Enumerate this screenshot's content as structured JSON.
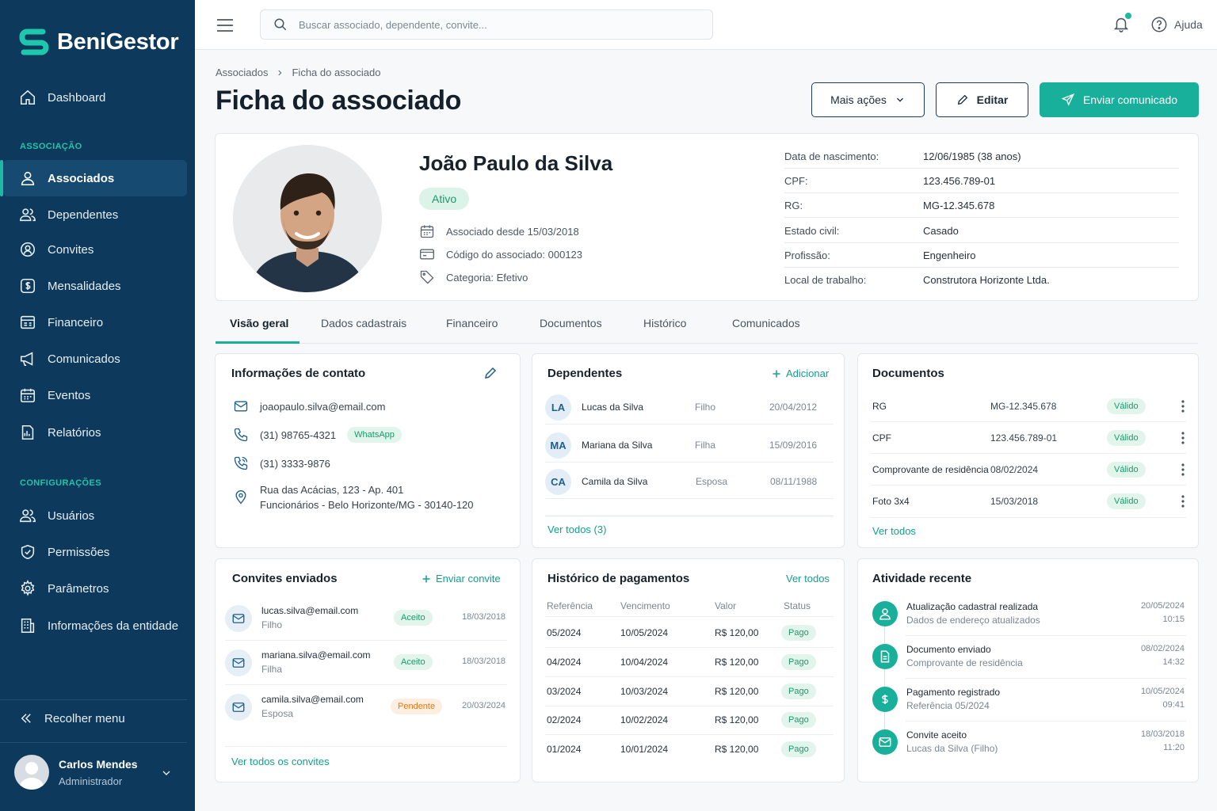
{
  "brand": {
    "name": "BeniGestor",
    "accent": "#18b09a",
    "sidebar_bg": "#0d3a5c"
  },
  "sidebar": {
    "items_top": [
      {
        "label": "Dashboard",
        "icon": "home-icon"
      }
    ],
    "section_assoc": "ASSOCIAÇÃO",
    "items_assoc": [
      {
        "label": "Associados",
        "icon": "user-icon",
        "active": true
      },
      {
        "label": "Dependentes",
        "icon": "users-icon"
      },
      {
        "label": "Convites",
        "icon": "invite-icon"
      },
      {
        "label": "Mensalidades",
        "icon": "dollar-icon"
      },
      {
        "label": "Financeiro",
        "icon": "finance-icon"
      },
      {
        "label": "Comunicados",
        "icon": "megaphone-icon"
      },
      {
        "label": "Eventos",
        "icon": "calendar-icon"
      },
      {
        "label": "Relatórios",
        "icon": "report-icon"
      }
    ],
    "section_config": "CONFIGURAÇÕES",
    "items_config": [
      {
        "label": "Usuários",
        "icon": "users-icon"
      },
      {
        "label": "Permissões",
        "icon": "shield-icon"
      },
      {
        "label": "Parâmetros",
        "icon": "gear-icon"
      },
      {
        "label": "Informações da entidade",
        "icon": "building-icon"
      }
    ],
    "collapse_label": "Recolher menu",
    "user": {
      "name": "Carlos Mendes",
      "role": "Administrador"
    }
  },
  "topbar": {
    "search_placeholder": "Buscar associado, dependente, convite...",
    "help_label": "Ajuda"
  },
  "header": {
    "breadcrumb": [
      "Associados",
      "Ficha do associado"
    ],
    "title": "Ficha do associado",
    "btn_more": "Mais ações",
    "btn_edit": "Editar",
    "btn_send": "Enviar comunicado"
  },
  "profile": {
    "name": "João Paulo da Silva",
    "status": "Ativo",
    "since": "Associado desde 15/03/2018",
    "code": "Código do associado: 000123",
    "category": "Categoria: Efetivo",
    "details": [
      {
        "k": "Data de nascimento:",
        "v": "12/06/1985 (38 anos)"
      },
      {
        "k": "CPF:",
        "v": "123.456.789-01"
      },
      {
        "k": "RG:",
        "v": "MG-12.345.678"
      },
      {
        "k": "Estado civil:",
        "v": "Casado"
      },
      {
        "k": "Profissão:",
        "v": "Engenheiro"
      },
      {
        "k": "Local de trabalho:",
        "v": "Construtora Horizonte Ltda."
      }
    ]
  },
  "tabs": [
    "Visão geral",
    "Dados cadastrais",
    "Financeiro",
    "Documentos",
    "Histórico",
    "Comunicados"
  ],
  "contact": {
    "title": "Informações de contato",
    "email": "joaopaulo.silva@email.com",
    "mobile": "(31) 98765-4321",
    "whatsapp": "WhatsApp",
    "phone": "(31) 3333-9876",
    "address1": "Rua das Acácias, 123 - Ap. 401",
    "address2": "Funcionários - Belo Horizonte/MG - 30140-120"
  },
  "dependents": {
    "title": "Dependentes",
    "add": "Adicionar",
    "rows": [
      {
        "initials": "LA",
        "name": "Lucas da Silva",
        "rel": "Filho",
        "date": "20/04/2012"
      },
      {
        "initials": "MA",
        "name": "Mariana da Silva",
        "rel": "Filha",
        "date": "15/09/2016"
      },
      {
        "initials": "CA",
        "name": "Camila da Silva",
        "rel": "Esposa",
        "date": "08/11/1988"
      }
    ],
    "see_all": "Ver todos (3)"
  },
  "documents": {
    "title": "Documentos",
    "rows": [
      {
        "name": "RG",
        "value": "MG-12.345.678",
        "status": "Válido"
      },
      {
        "name": "CPF",
        "value": "123.456.789-01",
        "status": "Válido"
      },
      {
        "name": "Comprovante de residência",
        "value": "08/02/2024",
        "status": "Válido"
      },
      {
        "name": "Foto 3x4",
        "value": "15/03/2018",
        "status": "Válido"
      }
    ],
    "see_all": "Ver todos"
  },
  "invites": {
    "title": "Convites enviados",
    "action": "Enviar convite",
    "rows": [
      {
        "email": "lucas.silva@email.com",
        "rel": "Filho",
        "status": "Aceito",
        "date": "18/03/2018"
      },
      {
        "email": "mariana.silva@email.com",
        "rel": "Filha",
        "status": "Aceito",
        "date": "18/03/2018"
      },
      {
        "email": "camila.silva@email.com",
        "rel": "Esposa",
        "status": "Pendente",
        "date": "20/03/2024"
      }
    ],
    "see_all": "Ver todos os convites"
  },
  "payments": {
    "title": "Histórico de pagamentos",
    "see_all": "Ver todos",
    "headers": [
      "Referência",
      "Vencimento",
      "Valor",
      "Status"
    ],
    "rows": [
      {
        "ref": "05/2024",
        "due": "10/05/2024",
        "value": "R$ 120,00",
        "status": "Pago"
      },
      {
        "ref": "04/2024",
        "due": "10/04/2024",
        "value": "R$ 120,00",
        "status": "Pago"
      },
      {
        "ref": "03/2024",
        "due": "10/03/2024",
        "value": "R$ 120,00",
        "status": "Pago"
      },
      {
        "ref": "02/2024",
        "due": "10/02/2024",
        "value": "R$ 120,00",
        "status": "Pago"
      },
      {
        "ref": "01/2024",
        "due": "10/01/2024",
        "value": "R$ 120,00",
        "status": "Pago"
      }
    ]
  },
  "activity": {
    "title": "Atividade recente",
    "rows": [
      {
        "icon": "user-icon",
        "title": "Atualização cadastral realizada",
        "sub": "Dados de endereço atualizados",
        "date": "20/05/2024",
        "time": "10:15"
      },
      {
        "icon": "document-icon",
        "title": "Documento enviado",
        "sub": "Comprovante de residência",
        "date": "08/02/2024",
        "time": "14:32"
      },
      {
        "icon": "dollar-icon",
        "title": "Pagamento registrado",
        "sub": "Referência 05/2024",
        "date": "10/05/2024",
        "time": "09:41"
      },
      {
        "icon": "mail-icon",
        "title": "Convite aceito",
        "sub": "Lucas da Silva (Filho)",
        "date": "18/03/2018",
        "time": "11:20"
      }
    ]
  }
}
